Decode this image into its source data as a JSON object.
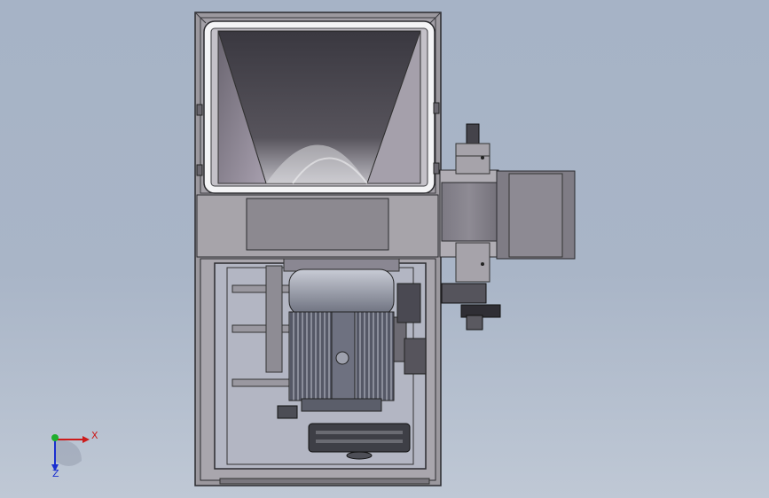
{
  "window": {
    "title": ""
  },
  "triad": {
    "x_label": "X",
    "z_label": "Z",
    "colors": {
      "x": "#cc1b1b",
      "y": "#1fae2d",
      "z": "#1a2fd0"
    }
  },
  "icons": [
    "hopper-icon",
    "motor-icon",
    "gearbox-icon",
    "coordinate-triad-icon"
  ],
  "colors": {
    "background": "#a9b5c7",
    "frame": "#9a979c",
    "hopper_dark": "#3e3c44",
    "motor_body": "#5f6270"
  }
}
